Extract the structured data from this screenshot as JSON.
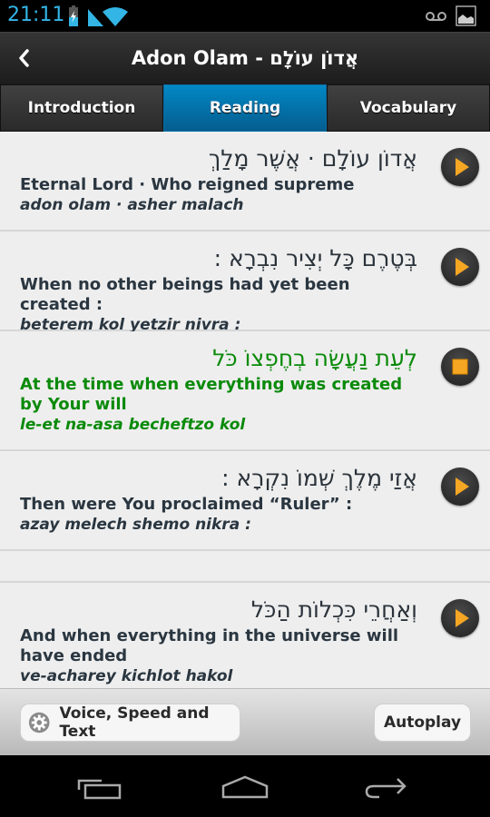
{
  "status_bar": {
    "time": "21:11",
    "icons": [
      "battery-charging-icon",
      "signal-icon",
      "wifi-icon",
      "voicemail-icon",
      "gallery-notification-icon"
    ]
  },
  "action_bar": {
    "back_icon": "chevron-left-icon",
    "title": "Adon Olam - אֲדוֹן עוֹלָם"
  },
  "tabs": [
    {
      "label": "Introduction",
      "active": false
    },
    {
      "label": "Reading",
      "active": true
    },
    {
      "label": "Vocabulary",
      "active": false
    }
  ],
  "verses": [
    {
      "hebrew": "אֲדוֹן עוֹלָם · אֲשֶׁר מָלַךְ",
      "english": "Eternal Lord · Who reigned supreme",
      "transliteration": "adon olam · asher malach",
      "state": "play"
    },
    {
      "hebrew": "בְּטֶרֶם כָּל יְצִיר נִבְרָא :",
      "english": "When no other beings had yet been created :",
      "transliteration": "beterem kol yetzir nivra :",
      "state": "play"
    },
    {
      "hebrew": "לְעֵת נַעֲשָׂה בְחֶפְצוֹ כֹּל",
      "english": "At the time when everything was created by Your will",
      "transliteration": "le-et na-asa becheftzo kol",
      "state": "stop"
    },
    {
      "hebrew": "אֲזַי מֶלֶךְ שְׁמוֹ נִקְרָא :",
      "english": "Then were You proclaimed “Ruler” :",
      "transliteration": "azay melech shemo nikra :",
      "state": "play"
    },
    {
      "hebrew": "וְאַחֲרֵי כִּכְלוֹת הַכֹּל",
      "english": "And when everything in the universe will have ended",
      "transliteration": "ve-acharey kichlot hakol",
      "state": "play"
    }
  ],
  "colors": {
    "accent_blue": "#0288c4",
    "active_verse": "#0a8a0a",
    "play_orange": "#f5a623",
    "clock": "#33b5e5"
  },
  "bottom_bar": {
    "voice_button": "Voice, Speed and Text",
    "autoplay_button": "Autoplay"
  },
  "nav_bar": {
    "icons": [
      "recent-apps-icon",
      "home-icon",
      "back-icon"
    ]
  }
}
